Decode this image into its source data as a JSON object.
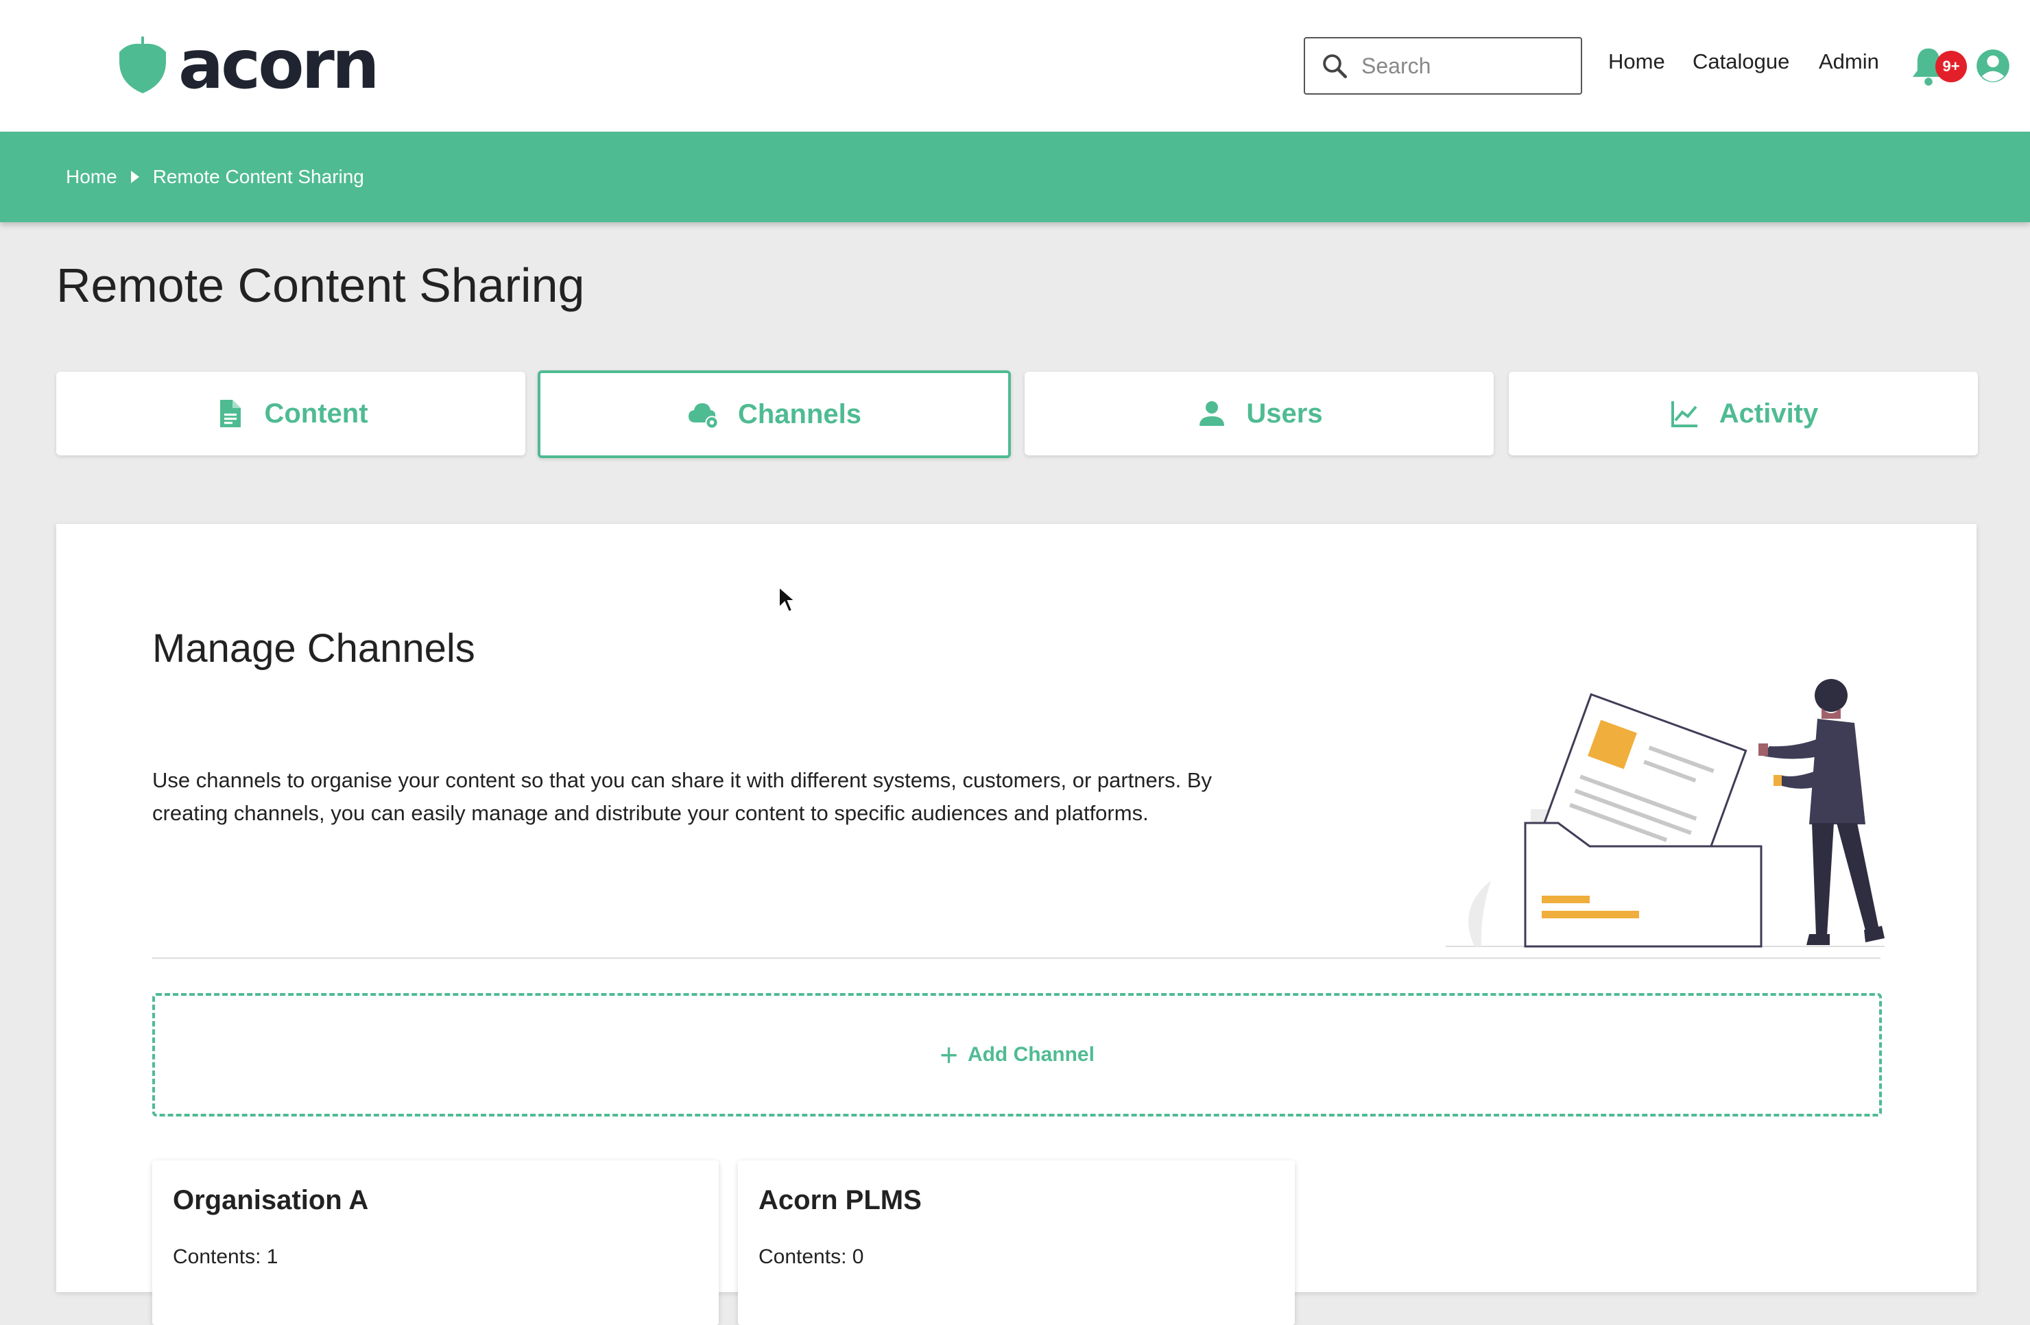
{
  "header": {
    "logo_text": "acorn",
    "search_placeholder": "Search",
    "nav": [
      "Home",
      "Catalogue",
      "Admin"
    ],
    "notification_badge": "9+"
  },
  "breadcrumb": [
    "Home",
    "Remote Content Sharing"
  ],
  "page_title": "Remote Content Sharing",
  "tabs": [
    {
      "label": "Content",
      "icon": "document-icon"
    },
    {
      "label": "Channels",
      "icon": "cloud-gear-icon",
      "active": true
    },
    {
      "label": "Users",
      "icon": "person-icon"
    },
    {
      "label": "Activity",
      "icon": "line-chart-icon"
    }
  ],
  "manage": {
    "title": "Manage Channels",
    "description": "Use channels to organise your content so that you can share it with different systems, customers, or partners. By creating channels, you can easily manage and distribute your content to specific audiences and platforms.",
    "add_label": "Add Channel"
  },
  "channels": [
    {
      "name": "Organisation A",
      "contents": "Contents: 1"
    },
    {
      "name": "Acorn PLMS",
      "contents": "Contents: 0"
    }
  ],
  "colors": {
    "accent": "#4fbb93",
    "badge": "#e3202a",
    "illustration": "#f0ae3c"
  }
}
